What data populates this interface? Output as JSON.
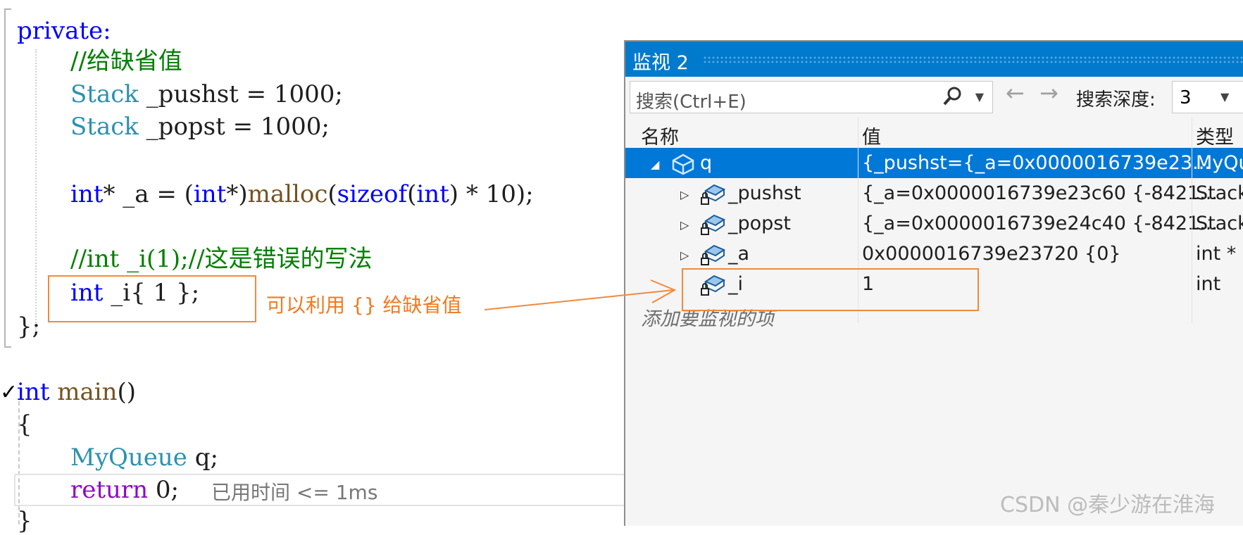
{
  "code": {
    "line_private": "private:",
    "line_comment1": "//给缺省值",
    "line_stack1": "Stack _pushst = 1000;",
    "line_stack2": "Stack _popst = 1000;",
    "line_malloc": "int* _a = (int*)malloc(sizeof(int) * 10);",
    "line_comment2": "//int _i(1);//这是错误的写法",
    "line_int_i": "int _i{ 1 };",
    "line_close": "};",
    "line_main": "int main()",
    "line_open_brace": "{",
    "line_myqueue": "MyQueue q;",
    "line_return": "return 0;",
    "elapsed_hint": "已用时间 <= 1ms",
    "last_brace": "}"
  },
  "annotation": {
    "text": "可以利用 {} 给缺省值",
    "color": "#f07a20"
  },
  "watch": {
    "title": "监视 2",
    "search_placeholder": "搜索(Ctrl+E)",
    "back_arrow": "←",
    "forward_arrow": "→",
    "depth_label": "搜索深度:",
    "depth_value": "3",
    "headers": {
      "name": "名称",
      "value": "值",
      "type": "类型"
    },
    "rows": [
      {
        "name": "q",
        "value": "{_pushst={_a=0x0000016739e23...",
        "type": "MyQu",
        "expander": "◢",
        "icon": "object-icon",
        "selected": true
      },
      {
        "name": "_pushst",
        "value": "{_a=0x0000016739e23c60 {-8421...",
        "type": "Stack",
        "expander": "▷",
        "icon": "private-field-icon"
      },
      {
        "name": "_popst",
        "value": "{_a=0x0000016739e24c40 {-8421...",
        "type": "Stack",
        "expander": "▷",
        "icon": "private-field-icon"
      },
      {
        "name": "_a",
        "value": "0x0000016739e23720 {0}",
        "type": "int *",
        "expander": "▷",
        "icon": "private-field-icon"
      },
      {
        "name": "_i",
        "value": "1",
        "type": "int",
        "expander": "",
        "icon": "private-field-icon"
      }
    ],
    "add_item": "添加要监视的项"
  },
  "watermark": "CSDN @秦少游在淮海",
  "colors": {
    "accent": "#007acc",
    "selection": "#0078d7",
    "annotation": "#f08a3c"
  }
}
